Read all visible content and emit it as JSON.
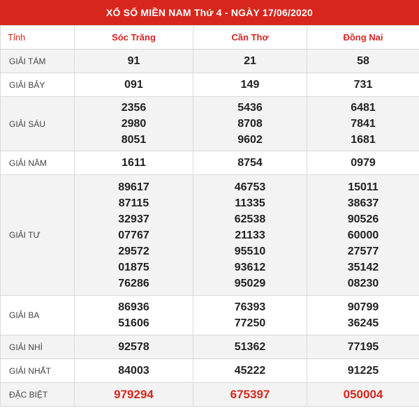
{
  "title": "XỔ SỐ MIỀN NAM Thứ 4 - NGÀY 17/06/2020",
  "header": {
    "label": "Tỉnh",
    "provinces": [
      "Sóc Trăng",
      "Cần Thơ",
      "Đồng Nai"
    ]
  },
  "rows": [
    {
      "label": "GIẢI TÁM",
      "values": [
        [
          "91"
        ],
        [
          "21"
        ],
        [
          "58"
        ]
      ]
    },
    {
      "label": "GIẢI BẢY",
      "values": [
        [
          "091"
        ],
        [
          "149"
        ],
        [
          "731"
        ]
      ]
    },
    {
      "label": "GIẢI SÁU",
      "values": [
        [
          "2356",
          "2980",
          "8051"
        ],
        [
          "5436",
          "8708",
          "9602"
        ],
        [
          "6481",
          "7841",
          "1681"
        ]
      ]
    },
    {
      "label": "GIẢI NĂM",
      "values": [
        [
          "1611"
        ],
        [
          "8754"
        ],
        [
          "0979"
        ]
      ]
    },
    {
      "label": "GIẢI TƯ",
      "values": [
        [
          "89617",
          "87115",
          "32937",
          "07767",
          "29572",
          "01875",
          "76286"
        ],
        [
          "46753",
          "11335",
          "62538",
          "21133",
          "95510",
          "93612",
          "95029"
        ],
        [
          "15011",
          "38637",
          "90526",
          "60000",
          "27577",
          "35142",
          "08230"
        ]
      ]
    },
    {
      "label": "GIẢI BA",
      "values": [
        [
          "86936",
          "51606"
        ],
        [
          "76393",
          "77250"
        ],
        [
          "90799",
          "36245"
        ]
      ]
    },
    {
      "label": "GIẢI NHÌ",
      "values": [
        [
          "92578"
        ],
        [
          "51362"
        ],
        [
          "77195"
        ]
      ]
    },
    {
      "label": "GIẢI NHẤT",
      "values": [
        [
          "84003"
        ],
        [
          "45222"
        ],
        [
          "91225"
        ]
      ]
    },
    {
      "label": "ĐẶC BIỆT",
      "values": [
        [
          "979294"
        ],
        [
          "675397"
        ],
        [
          "050004"
        ]
      ]
    }
  ],
  "colors": {
    "accent": "#d8261c",
    "alt_row": "#f3f3f3"
  }
}
